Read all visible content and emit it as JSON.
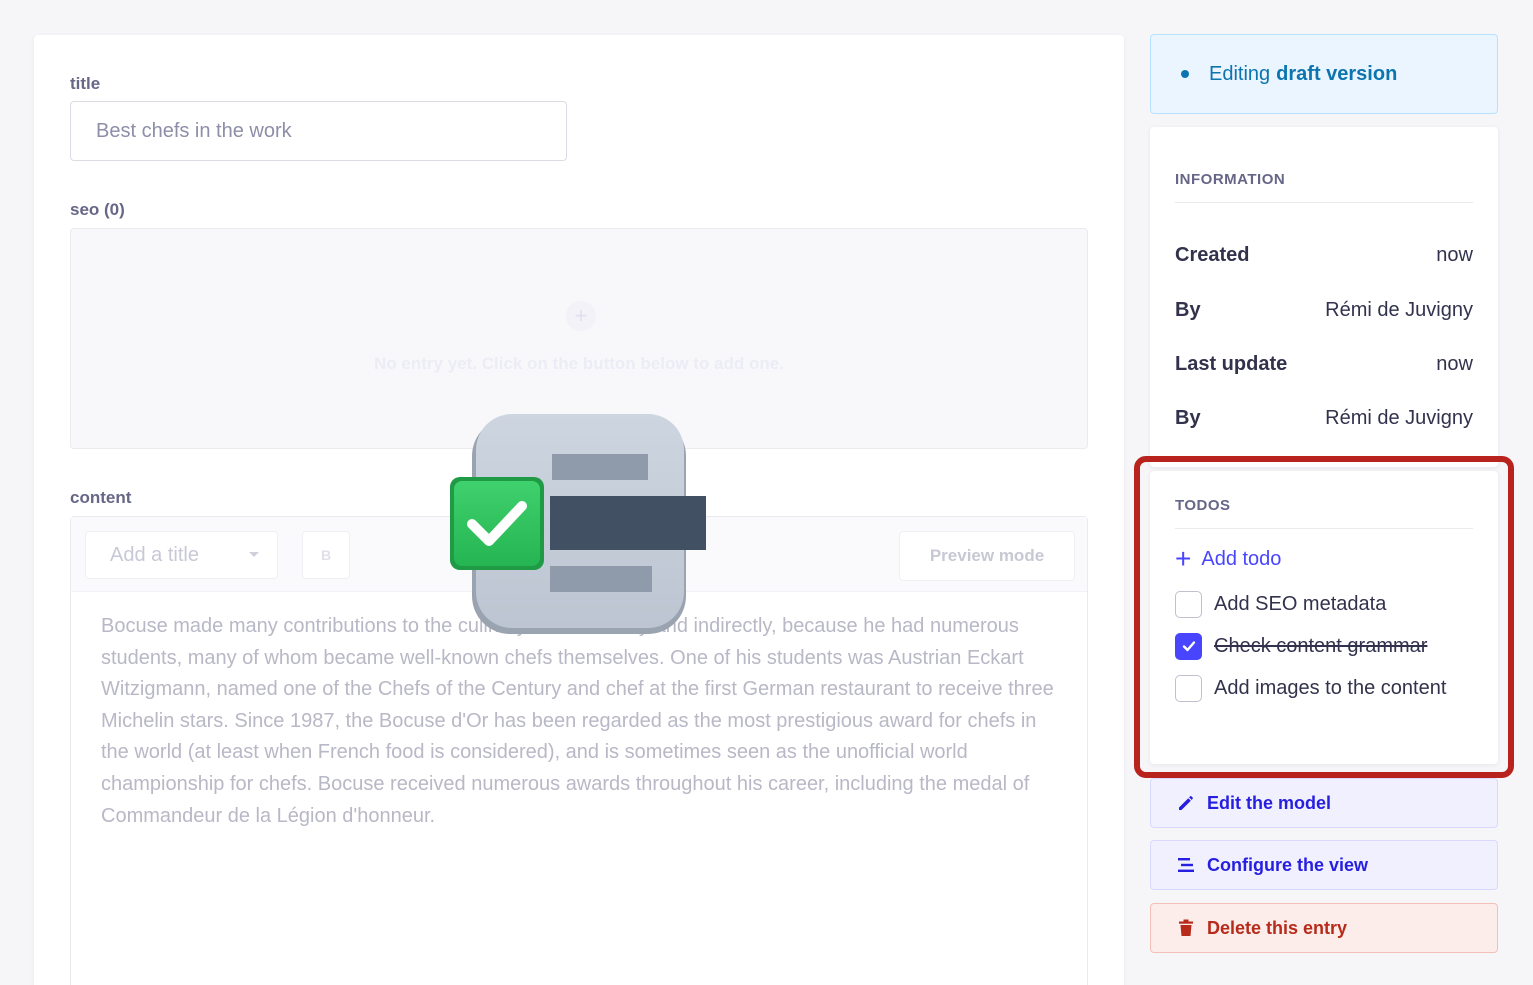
{
  "form": {
    "title_label": "title",
    "title_value": "Best chefs in the work",
    "seo_label": "seo (0)",
    "seo_empty_text": "No entry yet. Click on the button below to add one.",
    "content_label": "content",
    "toolbar": {
      "heading_select": "Add a title",
      "bold_label": "B",
      "preview_label": "Preview mode"
    },
    "content_text": "Bocuse made many contributions to the culinary world directly and indirectly, because he had numerous students, many of whom became well-known chefs themselves. One of his students was Austrian Eckart Witzigmann, named one of the Chefs of the Century and chef at the first German restaurant to receive three Michelin stars. Since 1987, the Bocuse d'Or has been regarded as the most prestigious award for chefs in the world (at least when French food is considered), and is sometimes seen as the unofficial world championship for chefs. Bocuse received numerous awards throughout his career, including the medal of Commandeur de la Légion d'honneur."
  },
  "sidebar": {
    "status": {
      "prefix": "Editing",
      "strong": "draft version"
    },
    "information": {
      "title": "INFORMATION",
      "rows": [
        {
          "key": "Created",
          "value": "now"
        },
        {
          "key": "By",
          "value": "Rémi de Juvigny"
        },
        {
          "key": "Last update",
          "value": "now"
        },
        {
          "key": "By",
          "value": "Rémi de Juvigny"
        }
      ]
    },
    "todos": {
      "title": "TODOS",
      "add_label": "Add todo",
      "items": [
        {
          "label": "Add SEO metadata",
          "checked": false
        },
        {
          "label": "Check content grammar",
          "checked": true
        },
        {
          "label": "Add images to the content",
          "checked": false
        }
      ]
    },
    "actions": {
      "edit_model": "Edit the model",
      "configure_view": "Configure the view",
      "delete_entry": "Delete this entry"
    }
  },
  "colors": {
    "primary": "#4945ff",
    "highlight_border": "#b8241d",
    "danger": "#b72b1a",
    "info": "#0c75af",
    "success": "#2ec55c"
  }
}
